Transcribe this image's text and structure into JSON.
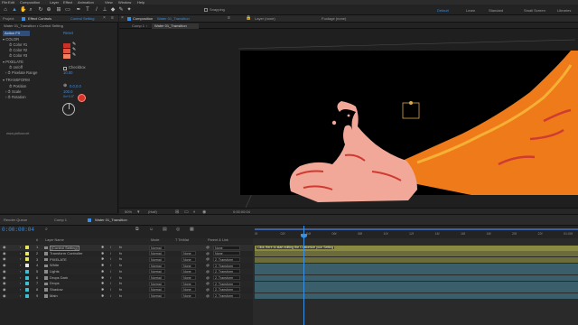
{
  "menu": [
    "File",
    "Edit",
    "Composition",
    "Layer",
    "Effect",
    "Animation",
    "View",
    "Window",
    "Help"
  ],
  "toolbar": {
    "snapping_label": "Snapping",
    "workspaces": [
      "Default",
      "Learn",
      "Standard",
      "Small Screen",
      "Libraries"
    ],
    "active_workspace": "Default"
  },
  "effect_controls": {
    "tab_project": "Project",
    "tab_label": "Effect Controls",
    "tab_layer": "Control Setting",
    "breadcrumb": "Water 01_Transition • Control Setting",
    "effect_name": "Action FX",
    "reset_label": "Reset",
    "section_color": "COLOR",
    "color1_label": "Color #1",
    "color2_label": "Color #2",
    "color3_label": "Color #3",
    "color1": "#c8322a",
    "color2": "#e0553e",
    "color3": "#f08060",
    "section_pixelate": "PIXELATE",
    "onoff_label": "on/off",
    "checkbox_label": "Checkbox",
    "pixelate_range_label": "Pixelate Range",
    "pixelate_range_value": "10.00",
    "section_transform": "TRANSFORM",
    "position_label": "Position",
    "position_value": "0.0,0.0",
    "scale_label": "Scale",
    "scale_value": "100.0",
    "rotation_label": "Rotation",
    "rotation_value": "0x+0.0°",
    "url": "www.pixflow.net"
  },
  "composition": {
    "tab_label": "Composition",
    "comp_name": "Water 01_Transition",
    "layer_label": "Layer (none)",
    "footage_label": "Footage (none)",
    "subtabs": [
      "Comp 1",
      "Water 01_Transition"
    ],
    "zoom": "50%",
    "resolution": "(Half)",
    "timecode": "0:00:00:04",
    "colors": {
      "background": "#000000",
      "liquid_orange": "#ef7a1a",
      "liquid_yellow": "#f6b035",
      "splash_pink": "#f1a898",
      "splash_red": "#cf3b33",
      "handle": "#d8a84a"
    }
  },
  "timeline": {
    "tabs": [
      "Render Queue",
      "Comp 1",
      "Water 01_Transition"
    ],
    "timecode": "0:00:00:04",
    "columns": {
      "num": "#",
      "layer_name": "Layer Name",
      "mode": "Mode",
      "trkmat": "T TrkMat",
      "parent": "Parent & Link"
    },
    "layers": [
      {
        "num": "1",
        "name": "[Control Setting]",
        "color": "#e6e65c",
        "mode": "Normal",
        "trk": "",
        "parent": "None"
      },
      {
        "num": "2",
        "name": "Transform Controller",
        "color": "#e6e65c",
        "mode": "Normal",
        "trk": "None",
        "parent": "None"
      },
      {
        "num": "3",
        "name": "PIXELATE",
        "color": "#e6e65c",
        "mode": "Normal",
        "trk": "None",
        "parent": "2. Transform"
      },
      {
        "num": "4",
        "name": "White",
        "color": "#e8e8e8",
        "mode": "Normal",
        "trk": "None",
        "parent": "2. Transform"
      },
      {
        "num": "5",
        "name": "Lights",
        "color": "#3fbfd4",
        "mode": "Normal",
        "trk": "None",
        "parent": "2. Transform"
      },
      {
        "num": "6",
        "name": "Drops Dark",
        "color": "#3fbfd4",
        "mode": "Normal",
        "trk": "None",
        "parent": "2. Transform"
      },
      {
        "num": "7",
        "name": "Drops",
        "color": "#3fbfd4",
        "mode": "Normal",
        "trk": "None",
        "parent": "2. Transform"
      },
      {
        "num": "8",
        "name": "Shadow",
        "color": "#3fbfd4",
        "mode": "Normal",
        "trk": "None",
        "parent": "2. Transform"
      },
      {
        "num": "9",
        "name": "Main",
        "color": "#3fbfd4",
        "mode": "Normal",
        "trk": "None",
        "parent": "2. Transform"
      }
    ],
    "ruler_ticks": [
      "0f",
      "02f",
      "04f",
      "06f",
      "08f",
      "10f",
      "12f",
      "14f",
      "16f",
      "18f",
      "20f",
      "22f",
      "01:00f"
    ],
    "control_layer_note": "Click Here to start editing the Customize your Setting"
  }
}
